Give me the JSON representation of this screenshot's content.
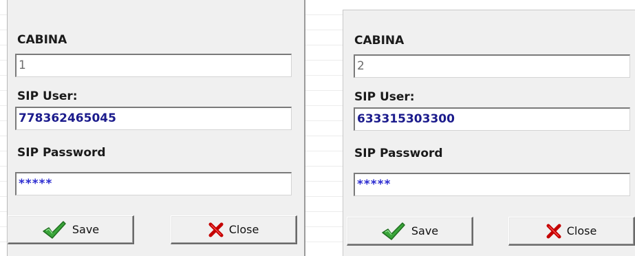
{
  "dialogs": [
    {
      "cabina_label": "CABINA",
      "cabina_value": "1",
      "sip_user_label": "SIP User:",
      "sip_user_value": "778362465045",
      "sip_password_label": "SIP Password",
      "sip_password_value": "*****",
      "save_label": "Save",
      "close_label": "Close"
    },
    {
      "cabina_label": "CABINA",
      "cabina_value": "2",
      "sip_user_label": "SIP User:",
      "sip_user_value": "633315303300",
      "sip_password_label": "SIP Password",
      "sip_password_value": "*****",
      "save_label": "Save",
      "close_label": "Close"
    }
  ],
  "icons": {
    "save": "green-checkmark-icon",
    "close": "red-x-icon"
  },
  "colors": {
    "dialog_bg": "#f0f0f0",
    "value_blue": "#1b1b8c",
    "password_blue": "#2a2ad0",
    "check_green": "#3aa53a",
    "close_red": "#c40000"
  }
}
